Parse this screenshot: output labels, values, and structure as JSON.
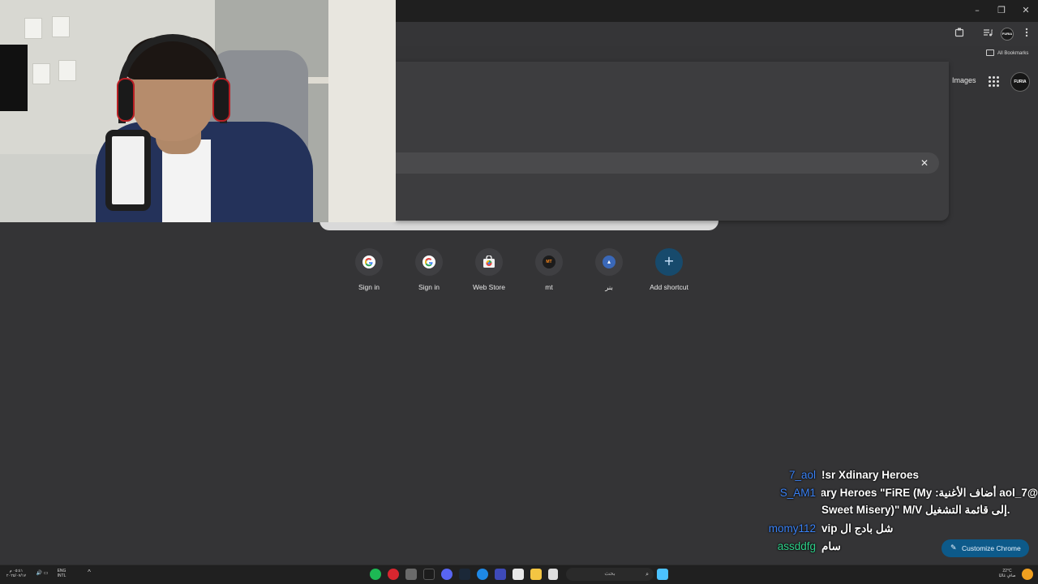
{
  "window": {
    "minimize": "–",
    "restore": "❐",
    "close": "✕"
  },
  "toolbar": {
    "profile_initials": "FURIA"
  },
  "bookmarks": {
    "label": "All Bookmarks"
  },
  "google": {
    "images_label": "Images",
    "profile_initials": "FURIA"
  },
  "search": {
    "clear": "✕"
  },
  "shortcuts": [
    {
      "label": "Sign in",
      "icon": "google-icon"
    },
    {
      "label": "Sign in",
      "icon": "google-icon"
    },
    {
      "label": "Web Store",
      "icon": "webstore-icon"
    },
    {
      "label": "mt",
      "icon": "mt-icon",
      "icon_text": "MT"
    },
    {
      "label": "بنر",
      "icon": "pin-icon"
    },
    {
      "label": "Add shortcut",
      "icon": "plus-icon",
      "icon_text": "+"
    }
  ],
  "chat": [
    {
      "user": "7_aol",
      "color": "#3b83f7",
      "message": "!sr Xdinary Heroes"
    },
    {
      "user": "S_AM1",
      "color": "#3b83f7",
      "message": "@7_aol أضاف الأغنية: Xdinary Heroes \"FiRE (My",
      "message_cont": "Sweet Misery)\" M/V إلى قائمة التشغيل."
    },
    {
      "user": "momy112",
      "color": "#3b83f7",
      "message": "vip شل بادج ال"
    },
    {
      "user": "assddfg",
      "color": "#2ed18a",
      "message": "سام"
    }
  ],
  "customize": {
    "label": "Customize Chrome",
    "pen": "✎"
  },
  "taskbar": {
    "date": "٢٠٢٥/٠٧/١٧",
    "time": "٠٥:٤١ م",
    "lang_top": "ENG",
    "lang_bottom": "INTL",
    "chevron": "^",
    "search_placeholder": "بحث",
    "search_glyph": "⌕",
    "weather_temp": "22°C",
    "weather_desc": "صافٍ غالبًا"
  },
  "colors": {
    "chrome_bg": "#343436",
    "accent": "#0d5a8a",
    "taskbar": "#202020"
  }
}
